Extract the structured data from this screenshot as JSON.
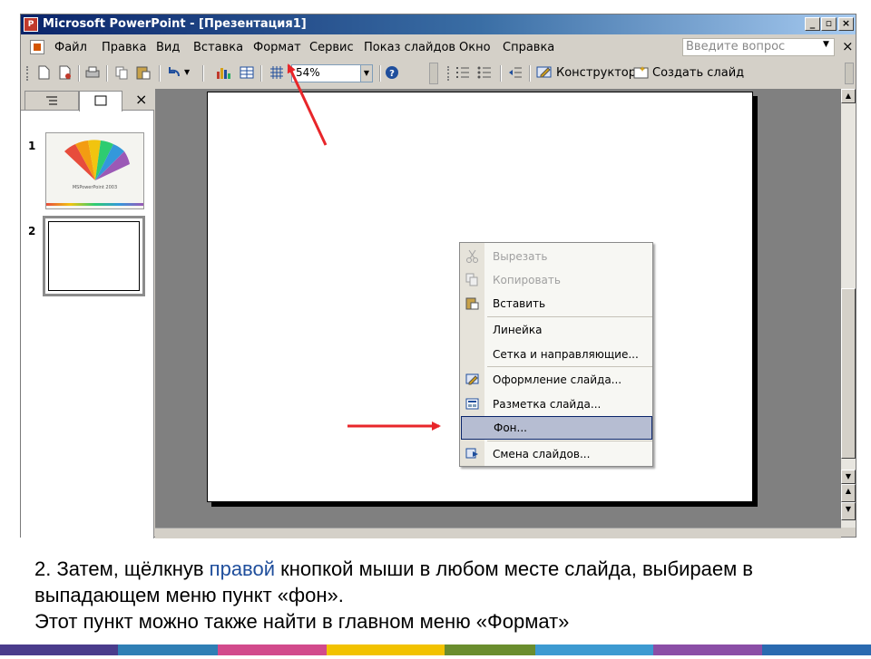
{
  "window": {
    "title": "Microsoft PowerPoint - [Презентация1]",
    "buttons": {
      "minimize": "_",
      "restore": "▫",
      "close": "×"
    }
  },
  "menubar": {
    "items": [
      "Файл",
      "Правка",
      "Вид",
      "Вставка",
      "Формат",
      "Сервис",
      "Показ слайдов",
      "Окно",
      "Справка"
    ],
    "help_placeholder": "Введите вопрос",
    "close_glyph": "×"
  },
  "toolbar": {
    "zoom": "54%",
    "designer_label": "Конструктор",
    "new_slide_label": "Создать слайд"
  },
  "slide_panel": {
    "slides": [
      {
        "number": "1",
        "thumb_title": "MSPowerPoint 2003"
      },
      {
        "number": "2"
      }
    ],
    "close_glyph": "×"
  },
  "context_menu": {
    "items": [
      {
        "label": "Вырезать",
        "icon": "scissors-icon",
        "enabled": false
      },
      {
        "label": "Копировать",
        "icon": "copy-icon",
        "enabled": false
      },
      {
        "label": "Вставить",
        "icon": "paste-icon",
        "enabled": true
      },
      {
        "label": "Линейка",
        "enabled": true
      },
      {
        "label": "Сетка и направляющие...",
        "enabled": true
      },
      {
        "label": "Оформление слайда...",
        "icon": "slide-design-icon",
        "enabled": true
      },
      {
        "label": "Разметка слайда...",
        "icon": "slide-layout-icon",
        "enabled": true
      },
      {
        "label": "Фон...",
        "enabled": true,
        "selected": true
      },
      {
        "label": "Смена слайдов...",
        "icon": "slide-transition-icon",
        "enabled": true
      }
    ]
  },
  "caption": {
    "line1_prefix": "2.   Затем, щёлкнув ",
    "line1_highlight": "правой",
    "line1_suffix": " кнопкой мыши в любом месте слайда, выбираем в",
    "line2": "выпадающем меню пункт «фон».",
    "line3": "Этот пункт можно также найти в главном меню «Формат»"
  },
  "colors": {
    "accent_arrow": "#e8262a",
    "caption_highlight": "#1f4e9c",
    "title_bar": "#0a246a",
    "menu_selected": "#b6bdd2"
  }
}
